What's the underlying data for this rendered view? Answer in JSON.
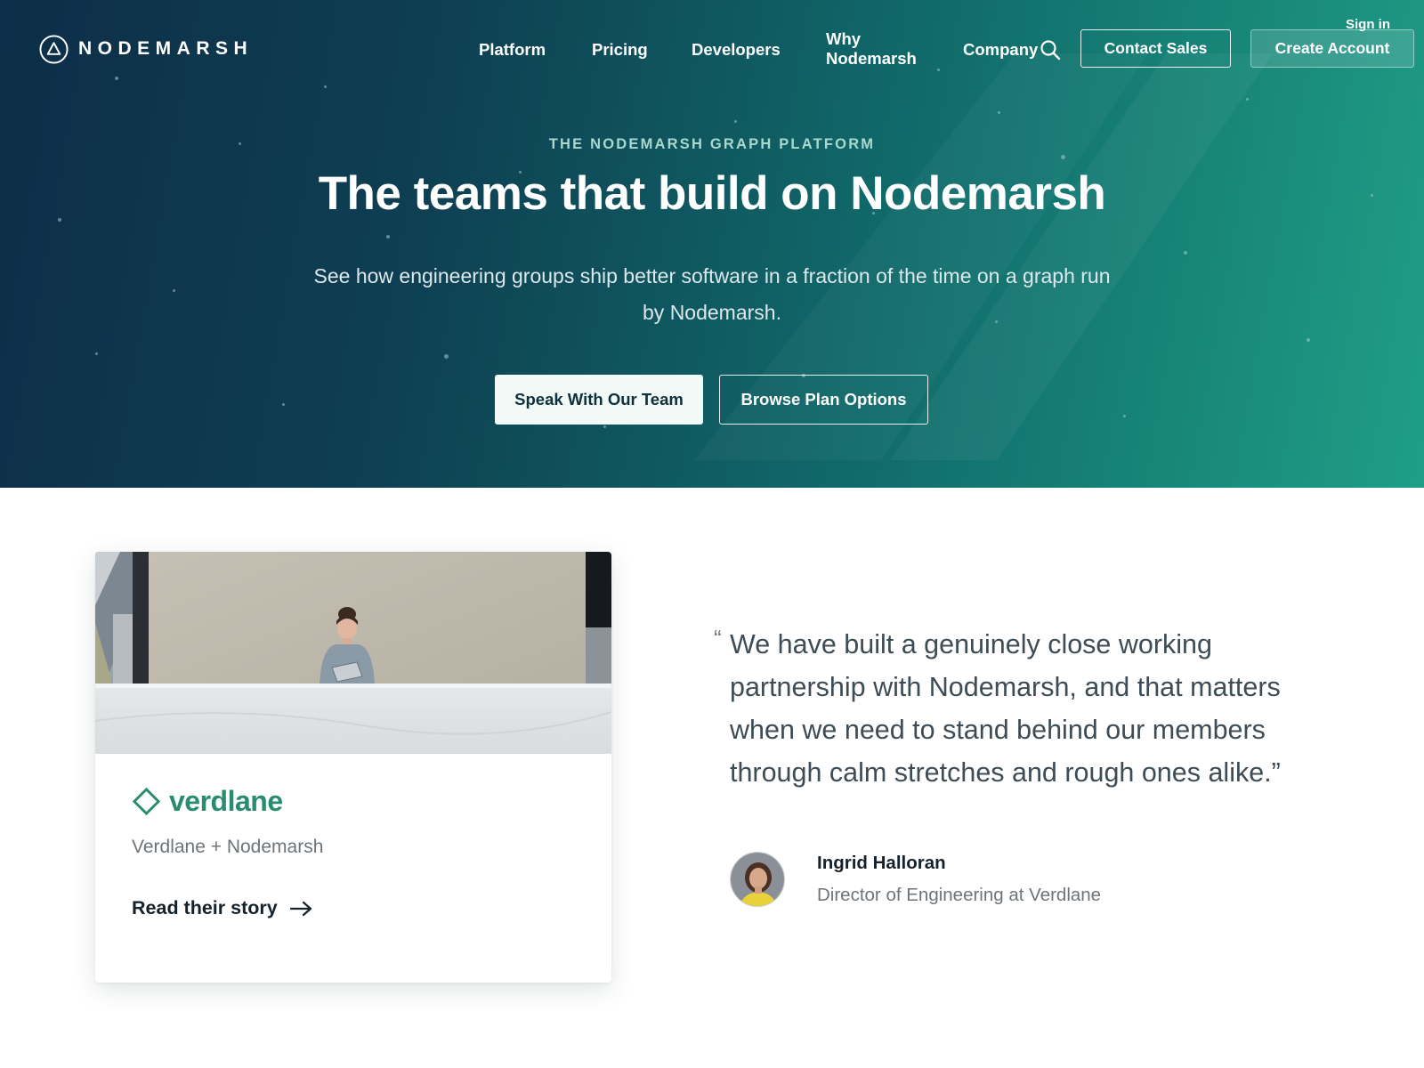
{
  "brand": {
    "logo_text": "NODEMARSH",
    "logo_icon": "triangle-in-circle-icon"
  },
  "nav": {
    "links": [
      "Platform",
      "Pricing",
      "Developers",
      "Why Nodemarsh",
      "Company"
    ],
    "sign_in": "Sign in",
    "contact_sales": "Contact Sales",
    "create_account": "Create Account",
    "search_icon": "search-icon"
  },
  "hero": {
    "eyebrow": "THE NODEMARSH GRAPH PLATFORM",
    "title": "The teams that build on Nodemarsh",
    "subtitle": "See how engineering groups ship better software in a fraction of the time on a graph run by Nodemarsh.",
    "primary_cta": "Speak With Our Team",
    "secondary_cta": "Browse Plan Options"
  },
  "case_study": {
    "company": "verdlane",
    "company_icon": "diamond-outline-icon",
    "subtitle": "Verdlane + Nodemarsh",
    "link": "Read their story",
    "link_icon": "arrow-right-icon"
  },
  "testimonial": {
    "open_mark": "“",
    "quote": "We have built a genuinely close working partnership with Nodemarsh, and that matters when we need to stand behind our members through calm stretches and rough ones alike.”",
    "name": "Ingrid Halloran",
    "title": "Director of Engineering at Verdlane"
  },
  "colors": {
    "hero_dark": "#0d2e48",
    "hero_teal": "#1f9e86",
    "brand_green": "#2a8c6e",
    "text_dark": "#15222b",
    "text_muted": "#6d7479"
  }
}
